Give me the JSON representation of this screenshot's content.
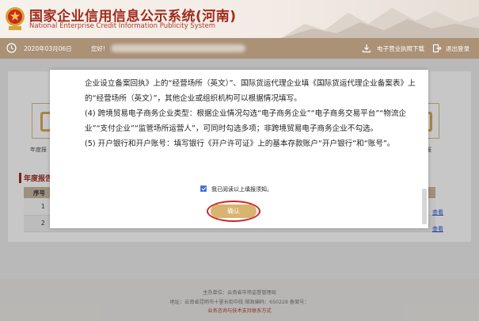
{
  "header": {
    "title_main": "国家企业信用信息公示系统",
    "title_province": "(河南)",
    "title_en": "National Enterprise Credit Information Publicity System"
  },
  "toolbar": {
    "date": "2020年03月06日",
    "greeting": "您好!",
    "download_license": "电子营业执照下载",
    "logout": "退出登录"
  },
  "background": {
    "cards": [
      {
        "label": "年度报"
      },
      {
        "label": ""
      },
      {
        "label": ""
      },
      {
        "label": "报"
      }
    ],
    "section_title": "年度报告",
    "table": {
      "headers": [
        "序号"
      ],
      "rows": [
        {
          "index": "1",
          "link": "查看"
        },
        {
          "index": "2",
          "link": "查看"
        }
      ]
    }
  },
  "modal": {
    "paragraphs": [
      "企业设立备案回执》上的“经营场所（英文）”、国际货运代理企业填《国际货运代理企业备案表》上的“经营场所（英文）”，其他企业或组织机构可以根据情况填写。",
      "(4) 跨境贸易电子商务企业类型：根据企业情况勾选“电子商务企业”“电子商务交易平台”“物流企业”“支付企业”“监管场所运营人”，可同时勾选多项；非跨境贸易电子商务企业不勾选。",
      "(5) 开户银行和开户账号：填写银行《开户许可证》上的基本存款账户“开户银行”和“账号”。"
    ],
    "agree_label": "我已阅读以上填报须知。",
    "agree_checked": true,
    "confirm_label": "确认"
  },
  "footer": {
    "line1": "主办单位：云南省市场监督管理局",
    "line2": "地址：云南省昆明市十里长街中段  邮政编码：650228  备案号：",
    "line3": "业务咨询与技术支持联系方式"
  },
  "colors": {
    "brand_red": "#a12a1c",
    "toolbar_bg": "#ab9175",
    "confirm_bg": "#d7b46f",
    "highlight_circle": "#d12424"
  }
}
